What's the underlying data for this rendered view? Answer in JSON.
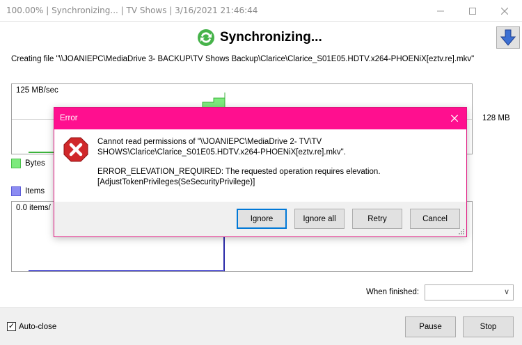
{
  "window": {
    "title": "100.00% | Synchronizing... | TV Shows | 3/16/2021 21:46:44"
  },
  "header": {
    "title": "Synchronizing..."
  },
  "status": {
    "creating": "Creating file \"\\\\JOANIEPC\\MediaDrive 3- BACKUP\\TV Shows Backup\\Clarice\\Clarice_S01E05.HDTV.x264-PHOENiX[eztv.re].mkv\""
  },
  "graphs": {
    "bytes": {
      "rate": "125 MB/sec",
      "side_value": "128 MB",
      "legend": "Bytes",
      "color": "#7dea7d"
    },
    "items": {
      "rate": "0.0 items/",
      "legend": "Items",
      "color": "#8c8cf2"
    }
  },
  "bottom": {
    "when_finished_label": "When finished:",
    "when_finished_value": "",
    "autoclose_label": "Auto-close",
    "autoclose_checked": true,
    "pause_label": "Pause",
    "stop_label": "Stop"
  },
  "dialog": {
    "title": "Error",
    "title_color": "#ff0f8f",
    "message_line1": "Cannot read permissions of \"\\\\JOANIEPC\\MediaDrive 2- TV\\TV SHOWS\\Clarice\\Clarice_S01E05.HDTV.x264-PHOENiX[eztv.re].mkv\".",
    "message_line2": "ERROR_ELEVATION_REQUIRED: The requested operation requires elevation. [AdjustTokenPrivileges(SeSecurityPrivilege)]",
    "buttons": {
      "ignore": "Ignore",
      "ignore_all": "Ignore all",
      "retry": "Retry",
      "cancel": "Cancel"
    }
  }
}
